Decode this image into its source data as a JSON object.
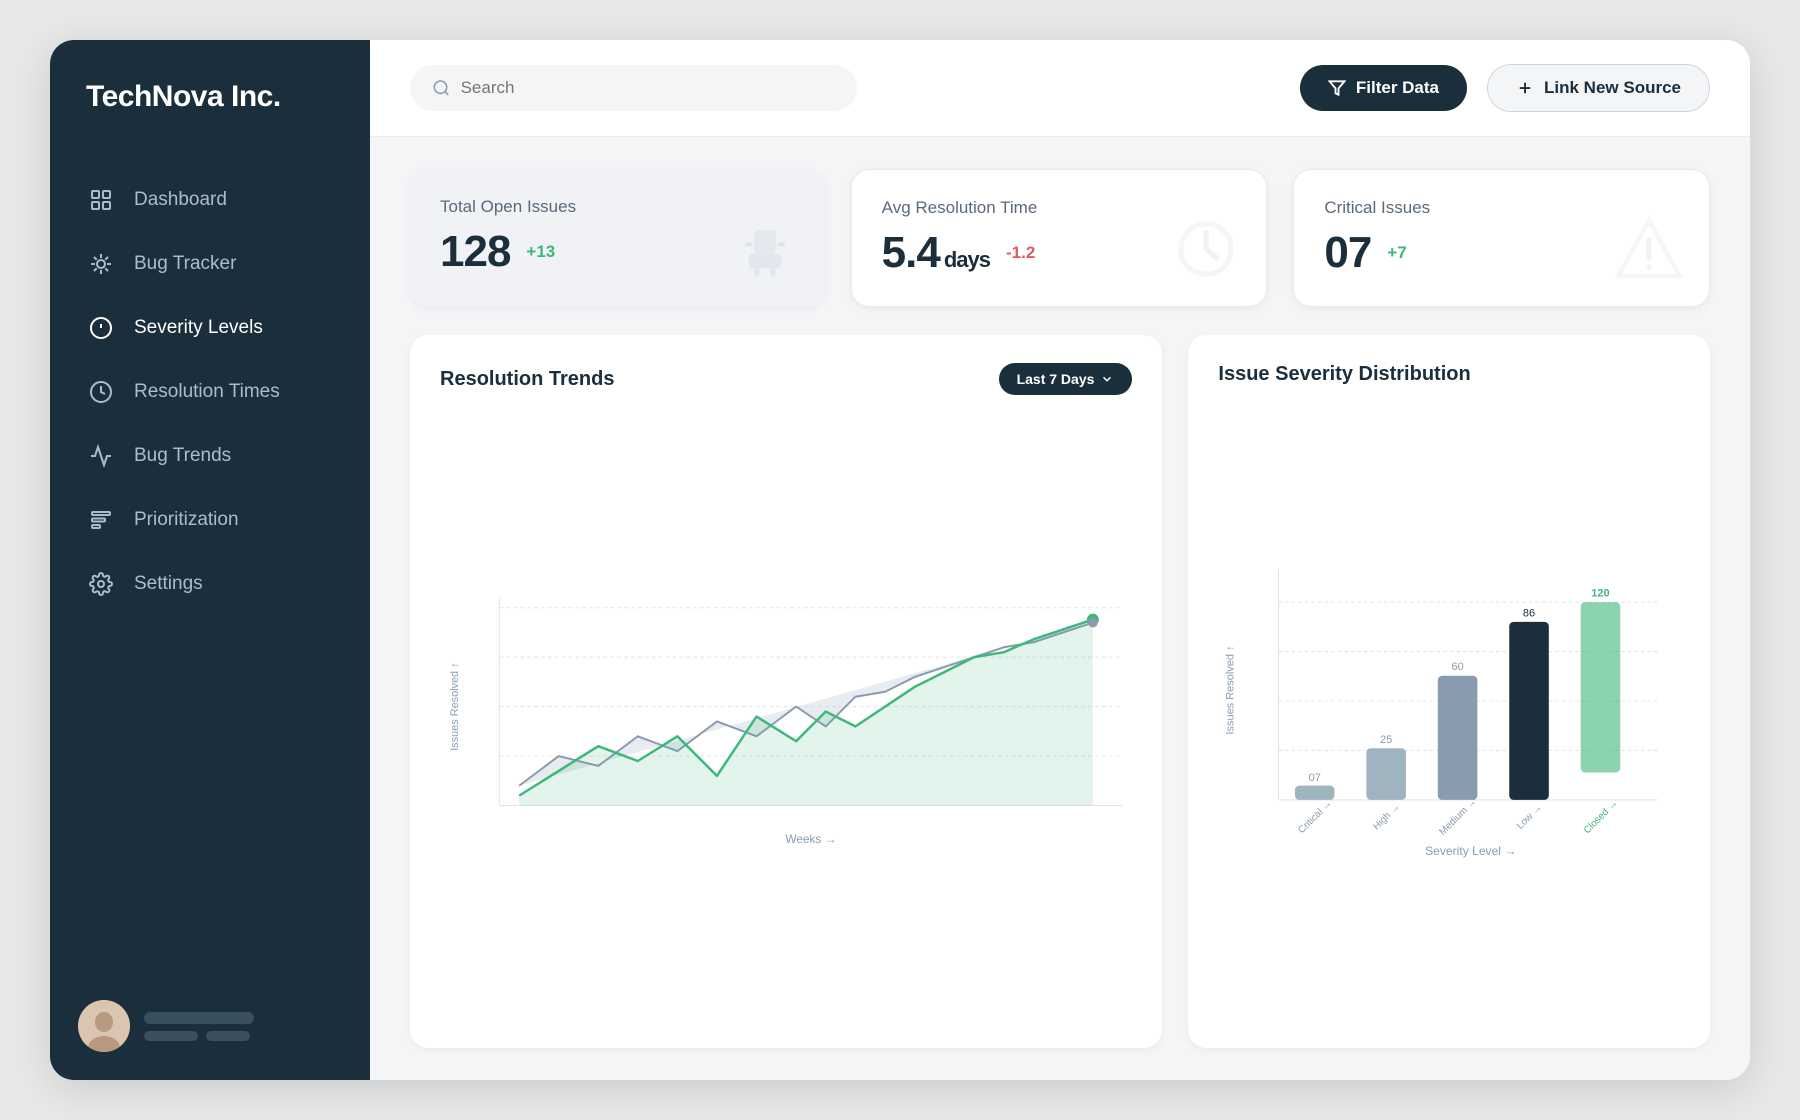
{
  "app": {
    "title": "TechNova Inc."
  },
  "header": {
    "search_placeholder": "Search",
    "filter_btn": "Filter Data",
    "link_source_btn": "Link New Source"
  },
  "sidebar": {
    "items": [
      {
        "id": "dashboard",
        "label": "Dashboard",
        "icon": "dashboard"
      },
      {
        "id": "bug-tracker",
        "label": "Bug Tracker",
        "icon": "bug"
      },
      {
        "id": "severity-levels",
        "label": "Severity Levels",
        "icon": "severity",
        "active": true
      },
      {
        "id": "resolution-times",
        "label": "Resolution Times",
        "icon": "clock"
      },
      {
        "id": "bug-trends",
        "label": "Bug Trends",
        "icon": "trends"
      },
      {
        "id": "prioritization",
        "label": "Prioritization",
        "icon": "prioritization"
      },
      {
        "id": "settings",
        "label": "Settings",
        "icon": "settings"
      }
    ]
  },
  "kpi": [
    {
      "id": "total-open-issues",
      "label": "Total Open Issues",
      "value": "128",
      "delta": "+13",
      "delta_type": "positive",
      "icon": "bug"
    },
    {
      "id": "avg-resolution-time",
      "label": "Avg Resolution Time",
      "value": "5.4",
      "unit": "days",
      "delta": "-1.2",
      "delta_type": "negative",
      "icon": "clock"
    },
    {
      "id": "critical-issues",
      "label": "Critical Issues",
      "value": "07",
      "delta": "+7",
      "delta_type": "positive",
      "icon": "warning"
    }
  ],
  "resolution_trends": {
    "title": "Resolution Trends",
    "period_btn": "Last 7 Days",
    "x_label": "Weeks →",
    "y_label": "Issues Resolved ↑"
  },
  "severity_distribution": {
    "title": "Issue Severity Distribution",
    "x_label": "Severity Level →",
    "y_label": "Issues Resolved ↑",
    "bars": [
      {
        "label": "Critical →",
        "value": 7,
        "color": "#8fa8b8"
      },
      {
        "label": "High →",
        "value": 25,
        "color": "#8fa8b8"
      },
      {
        "label": "Medium →",
        "value": 60,
        "color": "#8fa8b8"
      },
      {
        "label": "Low →",
        "value": 86,
        "color": "#1a2e3b"
      },
      {
        "label": "Closed →",
        "value": 120,
        "color": "#3db87a"
      }
    ]
  }
}
